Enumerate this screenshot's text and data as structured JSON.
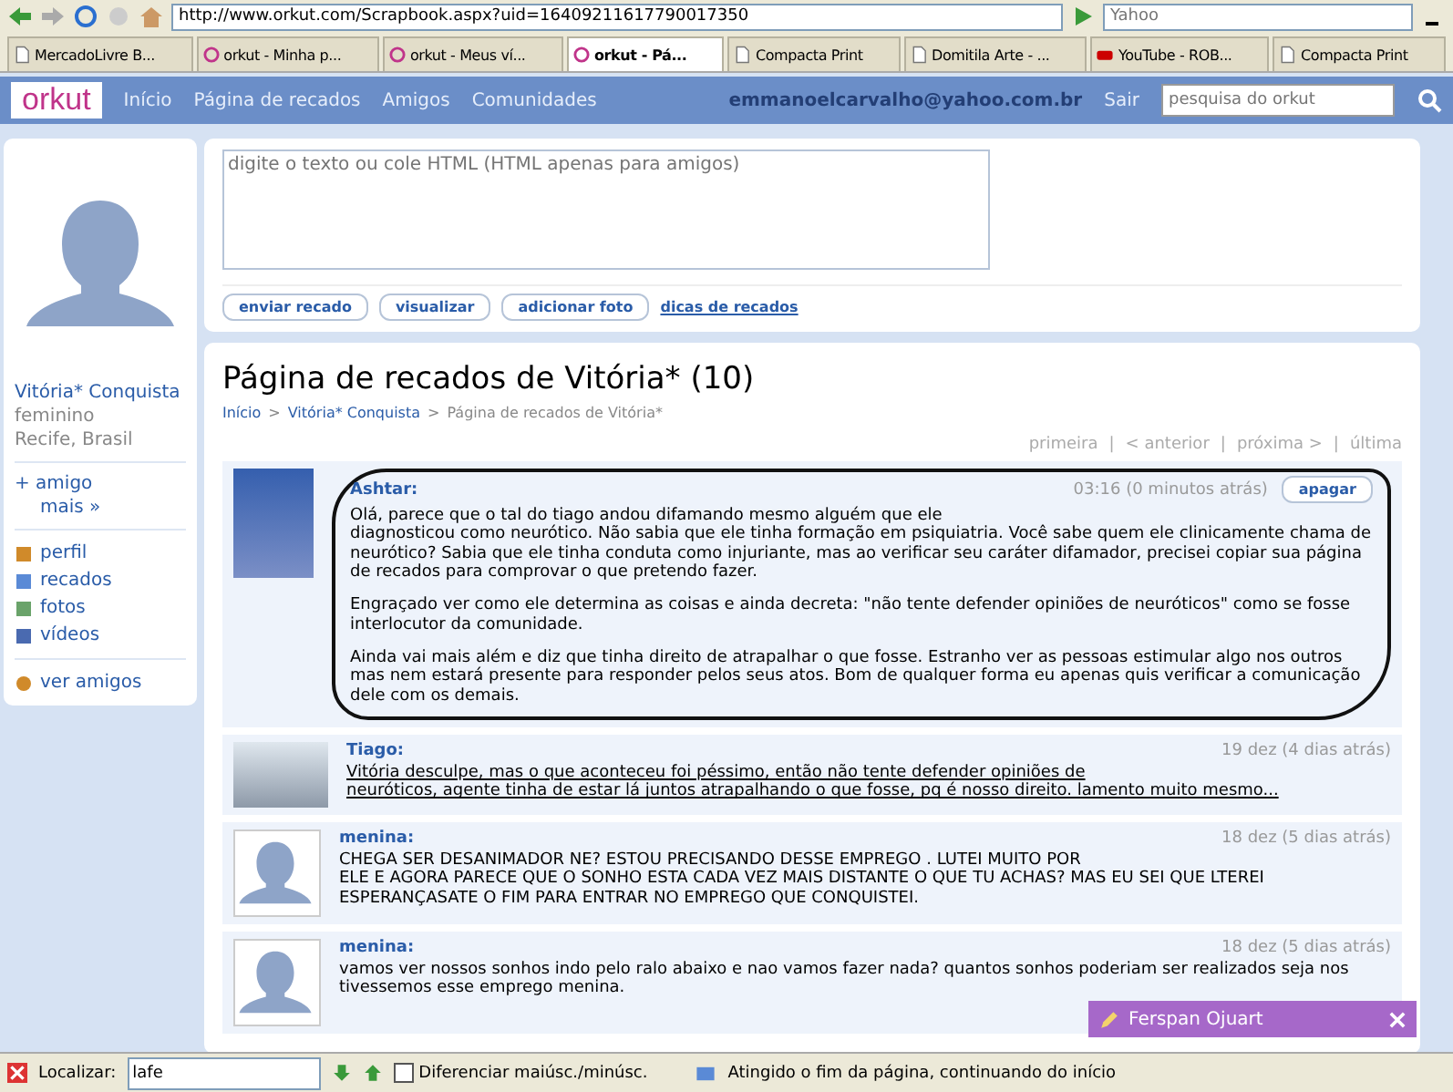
{
  "browser": {
    "url": "http://www.orkut.com/Scrapbook.aspx?uid=16409211617790017350",
    "search_placeholder": "Yahoo",
    "tabs": [
      {
        "label": "MercadoLivre B...",
        "kind": "page",
        "selected": false
      },
      {
        "label": "orkut - Minha p...",
        "kind": "orkut",
        "selected": false
      },
      {
        "label": "orkut - Meus ví...",
        "kind": "orkut",
        "selected": false
      },
      {
        "label": "orkut - Pá...",
        "kind": "orkut",
        "selected": true
      },
      {
        "label": "Compacta Print",
        "kind": "page",
        "selected": false
      },
      {
        "label": "Domitila Arte - ...",
        "kind": "page",
        "selected": false
      },
      {
        "label": "YouTube - ROB...",
        "kind": "youtube",
        "selected": false
      },
      {
        "label": "Compacta Print",
        "kind": "page",
        "selected": false
      }
    ]
  },
  "header": {
    "logo": "orkut",
    "nav": [
      "Início",
      "Página de recados",
      "Amigos",
      "Comunidades"
    ],
    "email": "emmanoelcarvalho@yahoo.com.br",
    "logout": "Sair",
    "search_placeholder": "pesquisa do orkut"
  },
  "sidebar": {
    "name": "Vitória* Conquista",
    "gender": "feminino",
    "location": "Recife, Brasil",
    "add_friend": "+ amigo",
    "more": "mais »",
    "menu": [
      {
        "label": "perfil",
        "kind": "profile"
      },
      {
        "label": "recados",
        "kind": "scraps"
      },
      {
        "label": "fotos",
        "kind": "photos"
      },
      {
        "label": "vídeos",
        "kind": "videos"
      }
    ],
    "friends": "ver amigos"
  },
  "composer": {
    "placeholder": "digite o texto ou cole HTML (HTML apenas para amigos)",
    "buttons": [
      "enviar recado",
      "visualizar",
      "adicionar foto"
    ],
    "link": "dicas de recados"
  },
  "scrapbook": {
    "title": "Página de recados de Vitória* (10)",
    "breadcrumb": [
      "Início",
      "Vitória* Conquista",
      "Página de recados de Vitória*"
    ],
    "breadcrumb_separators": [
      ">",
      ">"
    ],
    "pagination": [
      "primeira",
      "< anterior",
      "próxima >",
      "última"
    ],
    "pagination_separators": [
      "|",
      "|",
      "|"
    ],
    "scraps": [
      {
        "author": "Ashtar:",
        "time": "03:16 (0 minutos atrás)",
        "kind": "picture",
        "delete": "apagar",
        "circled": true,
        "paragraphs": [
          "Olá, parece que o tal do tiago andou difamando mesmo alguém que ele\ndiagnosticou como neurótico. Não sabia que ele tinha formação em psiquiatria. Você sabe quem ele clinicamente chama de neurótico? Sabia que ele tinha conduta como injuriante, mas ao verificar seu caráter difamador, precisei copiar sua página de recados para comprovar o que pretendo fazer.",
          "Engraçado ver como ele determina as coisas e ainda decreta: \"não tente defender opiniões de neuróticos\" como se fosse interlocutor da comunidade.",
          "Ainda vai mais além e diz que tinha direito de atrapalhar o que fosse. Estranho ver as pessoas estimular algo nos outros mas nem estará presente para responder pelos seus atos. Bom de qualquer forma eu apenas quis verificar a comunicação dele com os demais."
        ]
      },
      {
        "author": "Tiago:",
        "time": "19 dez (4 dias atrás)",
        "kind": "picture",
        "circled": false,
        "underlined": true,
        "paragraphs": [
          "Vitória desculpe, mas o que aconteceu foi péssimo, então não tente defender opiniões de\nneuróticos, agente tinha de estar lá juntos atrapalhando o que fosse, pq é nosso direito. lamento muito mesmo..."
        ]
      },
      {
        "author": "menina:",
        "time": "18 dez (5 dias atrás)",
        "kind": "silhouette",
        "circled": false,
        "underlined": false,
        "paragraphs": [
          "CHEGA SER DESANIMADOR NE? ESTOU PRECISANDO DESSE EMPREGO . LUTEI MUITO POR\nELE E AGORA PARECE QUE O SONHO ESTA CADA VEZ MAIS DISTANTE O QUE TU ACHAS? MAS EU SEI QUE LTEREI ESPERANÇASATE O FIM PARA ENTRAR NO EMPREGO QUE CONQUISTEI."
        ]
      },
      {
        "author": "menina:",
        "time": "18 dez (5 dias atrás)",
        "kind": "silhouette",
        "circled": false,
        "underlined": false,
        "paragraphs": [
          "vamos ver nossos sonhos indo pelo ralo abaixo e nao vamos fazer nada? quantos sonhos poderiam ser realizados seja nos tivessemos esse emprego menina."
        ]
      }
    ]
  },
  "chat_popup": {
    "name": "Ferspan Ojuart"
  },
  "findbar": {
    "label": "Localizar:",
    "value": "lafe",
    "match_case": {
      "label": "Diferenciar maiúsc./minúsc.",
      "checked": false
    },
    "status": "Atingido o fim da página, continuando do início"
  }
}
